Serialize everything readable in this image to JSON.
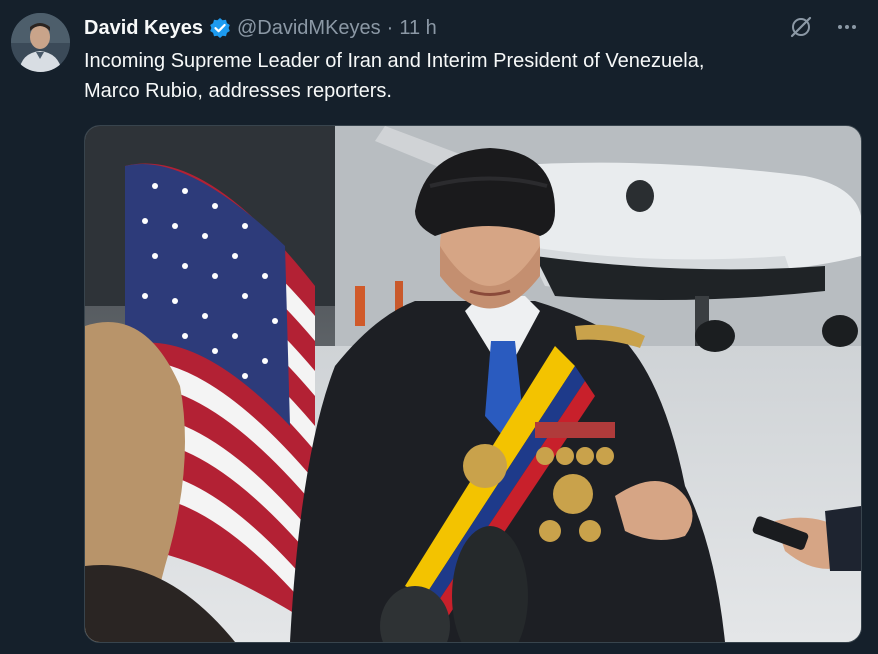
{
  "tweet": {
    "author_name": "David Keyes",
    "handle": "@DavidMKeyes",
    "separator": "·",
    "time": "11 h",
    "text_line1": "Incoming Supreme Leader of Iran and Interim President of Venezuela,",
    "text_line2": "Marco Rubio, addresses reporters."
  },
  "icons": {
    "verified": "verified-badge-icon",
    "grok": "grok-icon",
    "more": "more-icon"
  },
  "colors": {
    "background": "#15202b",
    "verified": "#1d9bf0",
    "secondary_text": "#8b98a5"
  }
}
